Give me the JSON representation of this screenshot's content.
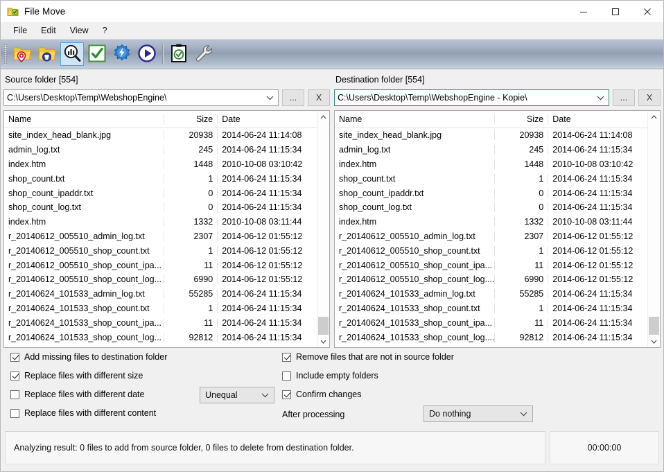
{
  "window": {
    "title": "File Move",
    "app_icon": "folder-green-check-icon",
    "controls": {
      "minimize": "minimize-icon",
      "maximize": "maximize-icon",
      "close": "close-icon"
    }
  },
  "menu": {
    "items": [
      {
        "label": "File",
        "name": "menu-file"
      },
      {
        "label": "Edit",
        "name": "menu-edit"
      },
      {
        "label": "View",
        "name": "menu-view"
      },
      {
        "label": "?",
        "name": "menu-help"
      }
    ]
  },
  "toolbar": {
    "buttons": [
      {
        "name": "select-source-folder-button",
        "icon": "folder-source-marker-icon",
        "selected": false
      },
      {
        "name": "select-destination-folder-button",
        "icon": "folder-destination-marker-icon",
        "selected": false
      },
      {
        "name": "analyze-button",
        "icon": "magnifier-chart-icon",
        "selected": true
      },
      {
        "name": "apply-button",
        "icon": "green-check-icon",
        "selected": false
      },
      {
        "name": "fast-sync-button",
        "icon": "blue-gear-lightning-icon",
        "selected": false
      },
      {
        "name": "start-button",
        "icon": "play-circle-icon",
        "selected": false
      },
      {
        "name": "log-button",
        "icon": "clipboard-check-icon",
        "selected": false
      },
      {
        "name": "settings-button",
        "icon": "wrench-icon",
        "selected": false
      }
    ]
  },
  "source": {
    "label": "Source folder [554]",
    "path": "C:\\Users\\Desktop\\Temp\\WebshopEngine\\",
    "focused": false,
    "browse_label": "...",
    "clear_label": "X",
    "columns": [
      "Name",
      "Size",
      "Date"
    ],
    "files": [
      {
        "name": "site_index_head_blank.jpg",
        "size": "20938",
        "date": "2014-06-24 11:14:08"
      },
      {
        "name": "admin_log.txt",
        "size": "245",
        "date": "2014-06-24 11:15:34"
      },
      {
        "name": "index.htm",
        "size": "1448",
        "date": "2010-10-08 03:10:42"
      },
      {
        "name": "shop_count.txt",
        "size": "1",
        "date": "2014-06-24 11:15:34"
      },
      {
        "name": "shop_count_ipaddr.txt",
        "size": "0",
        "date": "2014-06-24 11:15:34"
      },
      {
        "name": "shop_count_log.txt",
        "size": "0",
        "date": "2014-06-24 11:15:34"
      },
      {
        "name": "index.htm",
        "size": "1332",
        "date": "2010-10-08 03:11:44"
      },
      {
        "name": "r_20140612_005510_admin_log.txt",
        "size": "2307",
        "date": "2014-06-12 01:55:12"
      },
      {
        "name": "r_20140612_005510_shop_count.txt",
        "size": "1",
        "date": "2014-06-12 01:55:12"
      },
      {
        "name": "r_20140612_005510_shop_count_ipa...",
        "size": "11",
        "date": "2014-06-12 01:55:12"
      },
      {
        "name": "r_20140612_005510_shop_count_log...",
        "size": "6990",
        "date": "2014-06-12 01:55:12"
      },
      {
        "name": "r_20140624_101533_admin_log.txt",
        "size": "55285",
        "date": "2014-06-24 11:15:34"
      },
      {
        "name": "r_20140624_101533_shop_count.txt",
        "size": "1",
        "date": "2014-06-24 11:15:34"
      },
      {
        "name": "r_20140624_101533_shop_count_ipa...",
        "size": "11",
        "date": "2014-06-24 11:15:34"
      },
      {
        "name": "r_20140624_101533_shop_count_log...",
        "size": "92812",
        "date": "2014-06-24 11:15:34"
      }
    ]
  },
  "destination": {
    "label": "Destination folder [554]",
    "path": "C:\\Users\\Desktop\\Temp\\WebshopEngine - Kopie\\",
    "focused": true,
    "browse_label": "...",
    "clear_label": "X",
    "columns": [
      "Name",
      "Size",
      "Date"
    ],
    "files": [
      {
        "name": "site_index_head_blank.jpg",
        "size": "20938",
        "date": "2014-06-24 11:14:08"
      },
      {
        "name": "admin_log.txt",
        "size": "245",
        "date": "2014-06-24 11:15:34"
      },
      {
        "name": "index.htm",
        "size": "1448",
        "date": "2010-10-08 03:10:42"
      },
      {
        "name": "shop_count.txt",
        "size": "1",
        "date": "2014-06-24 11:15:34"
      },
      {
        "name": "shop_count_ipaddr.txt",
        "size": "0",
        "date": "2014-06-24 11:15:34"
      },
      {
        "name": "shop_count_log.txt",
        "size": "0",
        "date": "2014-06-24 11:15:34"
      },
      {
        "name": "index.htm",
        "size": "1332",
        "date": "2010-10-08 03:11:44"
      },
      {
        "name": "r_20140612_005510_admin_log.txt",
        "size": "2307",
        "date": "2014-06-12 01:55:12"
      },
      {
        "name": "r_20140612_005510_shop_count.txt",
        "size": "1",
        "date": "2014-06-12 01:55:12"
      },
      {
        "name": "r_20140612_005510_shop_count_ipa...",
        "size": "11",
        "date": "2014-06-12 01:55:12"
      },
      {
        "name": "r_20140612_005510_shop_count_log....",
        "size": "6990",
        "date": "2014-06-12 01:55:12"
      },
      {
        "name": "r_20140624_101533_admin_log.txt",
        "size": "55285",
        "date": "2014-06-24 11:15:34"
      },
      {
        "name": "r_20140624_101533_shop_count.txt",
        "size": "1",
        "date": "2014-06-24 11:15:34"
      },
      {
        "name": "r_20140624_101533_shop_count_ipa...",
        "size": "11",
        "date": "2014-06-24 11:15:34"
      },
      {
        "name": "r_20140624_101533_shop_count_log....",
        "size": "92812",
        "date": "2014-06-24 11:15:34"
      }
    ]
  },
  "options": {
    "add_missing": {
      "label": "Add missing files to destination folder",
      "checked": true
    },
    "replace_size": {
      "label": "Replace files with different size",
      "checked": true
    },
    "replace_date": {
      "label": "Replace files with different date",
      "checked": false
    },
    "replace_content": {
      "label": "Replace files with different content",
      "checked": false
    },
    "remove_not_in_source": {
      "label": "Remove files that are not in source folder",
      "checked": true
    },
    "include_empty": {
      "label": "Include empty folders",
      "checked": false
    },
    "confirm_changes": {
      "label": "Confirm changes",
      "checked": true
    },
    "date_compare_mode": {
      "value": "Unequal"
    },
    "after_processing_label": "After processing",
    "after_processing": {
      "value": "Do nothing"
    }
  },
  "status": {
    "message": "Analyzing result: 0 files to add from source folder, 0 files to delete from destination folder.",
    "elapsed": "00:00:00"
  }
}
